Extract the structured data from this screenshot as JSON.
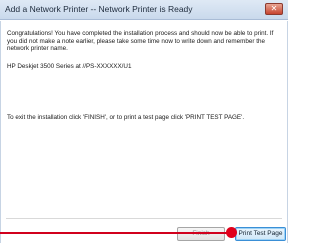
{
  "window": {
    "title": "Add a Network Printer -- Network Printer is Ready",
    "close_glyph": "✕"
  },
  "message": {
    "intro": "Congratulations! You have completed the installation process and should now be able to print. If you did not make a note earlier, please take some time now to write down and remember the network printer name.",
    "printer_name": "HP Deskjet 3500 Series at //PS-XXXXXX/U1",
    "instructions": "To exit the installation click 'FINISH', or to print a test page click 'PRINT TEST PAGE'."
  },
  "buttons": {
    "finish_label": "Finish",
    "print_test_label": "Print Test Page"
  },
  "colors": {
    "callout": "#e0001b",
    "focus_border": "#3a8fd6"
  }
}
